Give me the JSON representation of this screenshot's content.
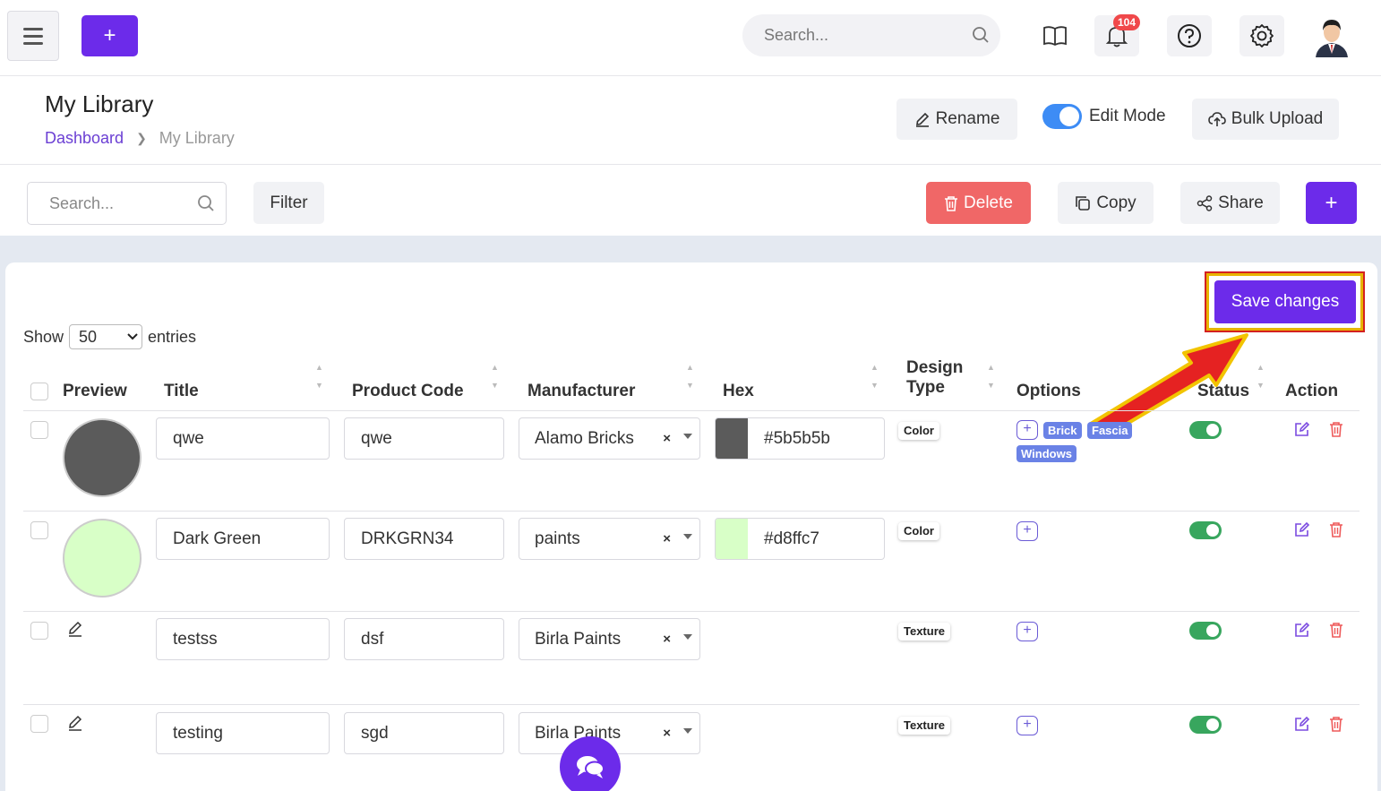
{
  "topbar": {
    "search_placeholder": "Search...",
    "notification_count": "104"
  },
  "header": {
    "title": "My Library",
    "breadcrumb": [
      "Dashboard",
      "My Library"
    ],
    "rename_label": "Rename",
    "edit_mode_label": "Edit Mode",
    "bulk_upload_label": "Bulk Upload"
  },
  "toolbar": {
    "search_placeholder": "Search...",
    "filter_label": "Filter",
    "delete_label": "Delete",
    "copy_label": "Copy",
    "share_label": "Share"
  },
  "save_label": "Save changes",
  "entries": {
    "show": "Show",
    "value": "50",
    "suffix": "entries"
  },
  "columns": {
    "preview": "Preview",
    "title": "Title",
    "product_code": "Product Code",
    "manufacturer": "Manufacturer",
    "hex": "Hex",
    "design_type_1": "Design",
    "design_type_2": "Type",
    "options": "Options",
    "status": "Status",
    "action": "Action"
  },
  "rows": [
    {
      "title": "qwe",
      "code": "qwe",
      "manufacturer": "Alamo Bricks",
      "hex": "#5b5b5b",
      "swatch": "#5b5b5b",
      "type": "Color",
      "tags": [
        "Brick",
        "Fascia",
        "Windows"
      ]
    },
    {
      "title": "Dark Green",
      "code": "DRKGRN34",
      "manufacturer": "paints",
      "hex": "#d8ffc7",
      "swatch": "#d8ffc7",
      "type": "Color",
      "tags": []
    },
    {
      "title": "testss",
      "code": "dsf",
      "manufacturer": "Birla Paints",
      "hex": "",
      "type": "Texture",
      "tags": []
    },
    {
      "title": "testing",
      "code": "sgd",
      "manufacturer": "Birla Paints",
      "hex": "",
      "type": "Texture",
      "tags": []
    }
  ]
}
